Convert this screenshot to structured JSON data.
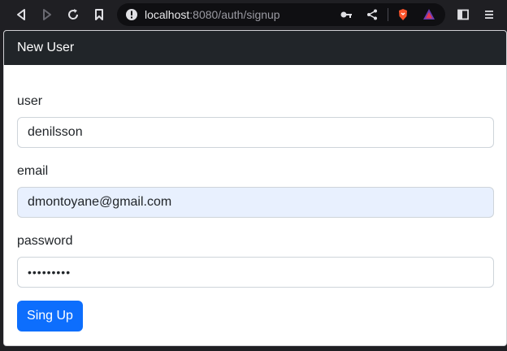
{
  "browser": {
    "url_host": "localhost",
    "url_rest": ":8080/auth/signup",
    "icons": {
      "back": "arrow-left-icon",
      "forward": "arrow-right-icon",
      "reload": "reload-icon",
      "bookmark": "bookmark-icon",
      "site_info": "info-icon",
      "key": "key-icon",
      "share": "share-icon",
      "brave": "brave-shield-icon",
      "rewards": "brave-rewards-icon",
      "sidebar": "sidebar-icon",
      "menu": "menu-icon"
    },
    "colors": {
      "brave": "#fb542b",
      "rewards_purple": "#6a3db0"
    }
  },
  "card": {
    "title": "New User"
  },
  "form": {
    "user_label": "user",
    "user_value": "denilsson",
    "email_label": "email",
    "email_value": "dmontoyane@gmail.com",
    "password_label": "password",
    "password_value": "•••••••••",
    "submit_label": "Sing Up"
  },
  "colors": {
    "header_bg": "#212529",
    "primary": "#0d6efd",
    "autofill_bg": "#e8f0fe"
  }
}
